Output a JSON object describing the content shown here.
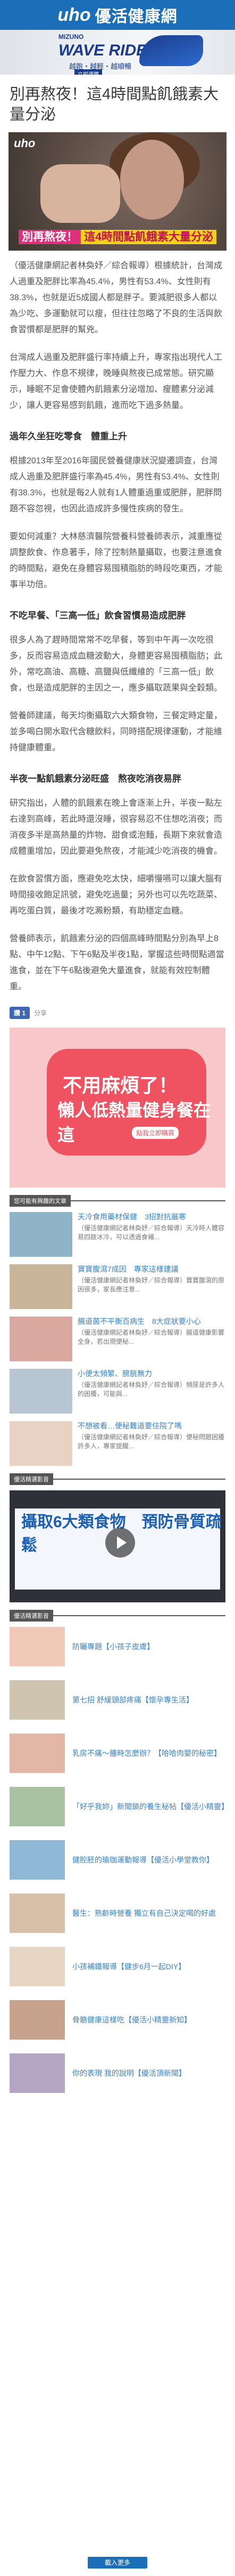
{
  "header": {
    "logo_latin": "uho",
    "logo_cn": "優活健康網"
  },
  "ad": {
    "brand": "MIZUNO",
    "model": "WAVE RIDER 22",
    "tagline": "越跑・越輕・越順暢",
    "cta": "立即選購"
  },
  "article": {
    "title": "別再熬夜！這4時間點飢餓素大量分泌",
    "hero_tag": "uho",
    "hero_caption_a": "別再熬夜！",
    "hero_caption_b": "這4時間點飢餓素大量分泌",
    "paragraphs": [
      "（優活健康網記者林奐妤／綜合報導）根據統計，台灣成人過重及肥胖比率為45.4%，男性有53.4%、女性則有38.3%，也就是近5成國人都是胖子。要減肥很多人都以為少吃、多運動就可以瘦，但往往忽略了不良的生活與飲食習慣都是肥胖的幫兇。",
      "台灣成人過重及肥胖盛行率持續上升，專家指出現代人工作壓力大、作息不規律，晚睡與熬夜已成常態。研究顯示，睡眠不足會使體內飢餓素分泌增加、瘦體素分泌減少，讓人更容易感到飢餓，進而吃下過多熱量。"
    ],
    "h_a": "過年久坐狂吃零食　體重上升",
    "sec_a": [
      "根據2013年至2016年國民營養健康狀況變遷調查，台灣成人過重及肥胖盛行率為45.4%，男性有53.4%、女性則有38.3%，也就是每2人就有1人體重過重或肥胖，肥胖問題不容忽視，也因此造成許多慢性疾病的發生。",
      "要如何減重？大林慈濟醫院營養科營養師表示，減重應從調整飲食、作息著手，除了控制熱量攝取，也要注意進食的時間點，避免在身體容易囤積脂肪的時段吃東西，才能事半功倍。"
    ],
    "h_b": "不吃早餐、「三高一低」飲食習慣易造成肥胖",
    "sec_b": [
      "很多人為了趕時間常常不吃早餐，等到中午再一次吃很多，反而容易造成血糖波動大，身體更容易囤積脂肪；此外，常吃高油、高糖、高鹽與低纖維的「三高一低」飲食，也是造成肥胖的主因之一，應多攝取蔬果與全穀類。",
      "營養師建議，每天均衡攝取六大類食物，三餐定時定量，並多喝白開水取代含糖飲料，同時搭配規律運動，才能維持健康體重。"
    ],
    "h_c": "半夜一點飢餓素分泌旺盛　熬夜吃消夜易胖",
    "sec_c": [
      "研究指出，人體的飢餓素在晚上會逐漸上升，半夜一點左右達到高峰，若此時還沒睡，很容易忍不住想吃消夜；而消夜多半是高熱量的炸物、甜食或泡麵，長期下來就會造成體重增加，因此要避免熬夜，才能減少吃消夜的機會。",
      "在飲食習慣方面，應避免吃太快，細嚼慢嚥可以讓大腦有時間接收飽足訊號，避免吃過量；另外也可以先吃蔬菜、再吃蛋白質，最後才吃澱粉類，有助穩定血糖。",
      "營養師表示，飢餓素分泌的四個高峰時間點分別為早上8點、中午12點、下午6點及半夜1點，掌握這些時間點適當進食，並在下午6點後避免大量進食，就能有效控制體重。"
    ]
  },
  "social": {
    "like_label": "讚 1",
    "share_label": "分享"
  },
  "promo": {
    "line1": "不用麻煩了！",
    "line2": "懶人低熱量健身餐在這",
    "cta": "點我立即購買"
  },
  "related_label": "您可能有興趣的文章",
  "related": [
    {
      "title": "天冷食用藥材保健　3招對抗嚴寒",
      "desc": "（優活健康網記者林奐妤／綜合報導）天冷時人體容易四肢冰冷，可以透過食補..."
    },
    {
      "title": "寶寶腹瀉7成因　專家這樣建議",
      "desc": "（優活健康網記者林奐妤／綜合報導）寶寶腹瀉的原因很多，家長應注意..."
    },
    {
      "title": "腸道菌不平衡百病生　8大症狀要小心",
      "desc": "（優活健康網記者林奐妤／綜合報導）腸道健康影響全身，若出現便秘..."
    },
    {
      "title": "小便太頻繁、膀胱無力",
      "desc": "（優活健康網記者林奐妤／綜合報導）頻尿是許多人的困擾，可能與..."
    },
    {
      "title": "不想被看…便秘難道要住院了嗎",
      "desc": "（優活健康網記者林奐妤／綜合報導）便秘問題困擾許多人，專家提醒..."
    }
  ],
  "video_label": "優活精選影音",
  "video": {
    "title": "攝取6大類食物　預防骨質疏鬆"
  },
  "more_label": "優活精選影音",
  "more": [
    {
      "title": "防曬專題【小孩子皮膚】"
    },
    {
      "title": "第七招 舒緩頸部疼痛【懷孕專生活】"
    },
    {
      "title": "乳房不痛～腫時怎麼辦？【哈哈肉嬰的秘密】"
    },
    {
      "title": "「好乎我妳」新聞鎖的養生秘帖【優活小精靈】"
    },
    {
      "title": "健腔胚的瑜珈運動報導【優活小學堂教你】"
    },
    {
      "title": "醫生：熟齡時營養 獨立有自己決定喝的好處"
    },
    {
      "title": "小孩補鐵報導【健步6月一起DIY】"
    },
    {
      "title": "骨骼健康這樣吃【優活小精靈新知】"
    },
    {
      "title": "你的表現 我的說明【優活頂新聞】"
    }
  ],
  "load_more": "載入更多"
}
